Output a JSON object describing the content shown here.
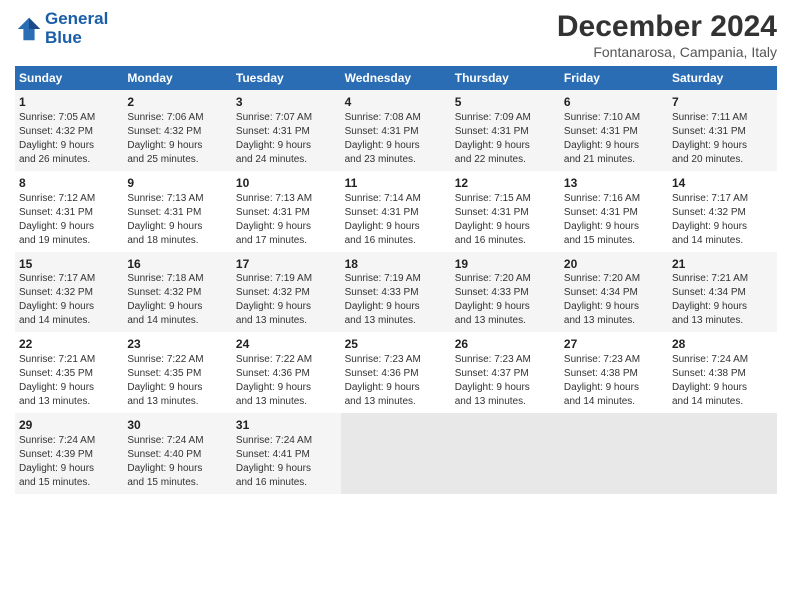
{
  "header": {
    "logo_line1": "General",
    "logo_line2": "Blue",
    "month": "December 2024",
    "location": "Fontanarosa, Campania, Italy"
  },
  "days_of_week": [
    "Sunday",
    "Monday",
    "Tuesday",
    "Wednesday",
    "Thursday",
    "Friday",
    "Saturday"
  ],
  "weeks": [
    [
      {
        "day": "1",
        "sunrise": "7:05 AM",
        "sunset": "4:32 PM",
        "daylight": "9 hours and 26 minutes."
      },
      {
        "day": "2",
        "sunrise": "7:06 AM",
        "sunset": "4:32 PM",
        "daylight": "9 hours and 25 minutes."
      },
      {
        "day": "3",
        "sunrise": "7:07 AM",
        "sunset": "4:31 PM",
        "daylight": "9 hours and 24 minutes."
      },
      {
        "day": "4",
        "sunrise": "7:08 AM",
        "sunset": "4:31 PM",
        "daylight": "9 hours and 23 minutes."
      },
      {
        "day": "5",
        "sunrise": "7:09 AM",
        "sunset": "4:31 PM",
        "daylight": "9 hours and 22 minutes."
      },
      {
        "day": "6",
        "sunrise": "7:10 AM",
        "sunset": "4:31 PM",
        "daylight": "9 hours and 21 minutes."
      },
      {
        "day": "7",
        "sunrise": "7:11 AM",
        "sunset": "4:31 PM",
        "daylight": "9 hours and 20 minutes."
      }
    ],
    [
      {
        "day": "8",
        "sunrise": "7:12 AM",
        "sunset": "4:31 PM",
        "daylight": "9 hours and 19 minutes."
      },
      {
        "day": "9",
        "sunrise": "7:13 AM",
        "sunset": "4:31 PM",
        "daylight": "9 hours and 18 minutes."
      },
      {
        "day": "10",
        "sunrise": "7:13 AM",
        "sunset": "4:31 PM",
        "daylight": "9 hours and 17 minutes."
      },
      {
        "day": "11",
        "sunrise": "7:14 AM",
        "sunset": "4:31 PM",
        "daylight": "9 hours and 16 minutes."
      },
      {
        "day": "12",
        "sunrise": "7:15 AM",
        "sunset": "4:31 PM",
        "daylight": "9 hours and 16 minutes."
      },
      {
        "day": "13",
        "sunrise": "7:16 AM",
        "sunset": "4:31 PM",
        "daylight": "9 hours and 15 minutes."
      },
      {
        "day": "14",
        "sunrise": "7:17 AM",
        "sunset": "4:32 PM",
        "daylight": "9 hours and 14 minutes."
      }
    ],
    [
      {
        "day": "15",
        "sunrise": "7:17 AM",
        "sunset": "4:32 PM",
        "daylight": "9 hours and 14 minutes."
      },
      {
        "day": "16",
        "sunrise": "7:18 AM",
        "sunset": "4:32 PM",
        "daylight": "9 hours and 14 minutes."
      },
      {
        "day": "17",
        "sunrise": "7:19 AM",
        "sunset": "4:32 PM",
        "daylight": "9 hours and 13 minutes."
      },
      {
        "day": "18",
        "sunrise": "7:19 AM",
        "sunset": "4:33 PM",
        "daylight": "9 hours and 13 minutes."
      },
      {
        "day": "19",
        "sunrise": "7:20 AM",
        "sunset": "4:33 PM",
        "daylight": "9 hours and 13 minutes."
      },
      {
        "day": "20",
        "sunrise": "7:20 AM",
        "sunset": "4:34 PM",
        "daylight": "9 hours and 13 minutes."
      },
      {
        "day": "21",
        "sunrise": "7:21 AM",
        "sunset": "4:34 PM",
        "daylight": "9 hours and 13 minutes."
      }
    ],
    [
      {
        "day": "22",
        "sunrise": "7:21 AM",
        "sunset": "4:35 PM",
        "daylight": "9 hours and 13 minutes."
      },
      {
        "day": "23",
        "sunrise": "7:22 AM",
        "sunset": "4:35 PM",
        "daylight": "9 hours and 13 minutes."
      },
      {
        "day": "24",
        "sunrise": "7:22 AM",
        "sunset": "4:36 PM",
        "daylight": "9 hours and 13 minutes."
      },
      {
        "day": "25",
        "sunrise": "7:23 AM",
        "sunset": "4:36 PM",
        "daylight": "9 hours and 13 minutes."
      },
      {
        "day": "26",
        "sunrise": "7:23 AM",
        "sunset": "4:37 PM",
        "daylight": "9 hours and 13 minutes."
      },
      {
        "day": "27",
        "sunrise": "7:23 AM",
        "sunset": "4:38 PM",
        "daylight": "9 hours and 14 minutes."
      },
      {
        "day": "28",
        "sunrise": "7:24 AM",
        "sunset": "4:38 PM",
        "daylight": "9 hours and 14 minutes."
      }
    ],
    [
      {
        "day": "29",
        "sunrise": "7:24 AM",
        "sunset": "4:39 PM",
        "daylight": "9 hours and 15 minutes."
      },
      {
        "day": "30",
        "sunrise": "7:24 AM",
        "sunset": "4:40 PM",
        "daylight": "9 hours and 15 minutes."
      },
      {
        "day": "31",
        "sunrise": "7:24 AM",
        "sunset": "4:41 PM",
        "daylight": "9 hours and 16 minutes."
      },
      null,
      null,
      null,
      null
    ]
  ]
}
